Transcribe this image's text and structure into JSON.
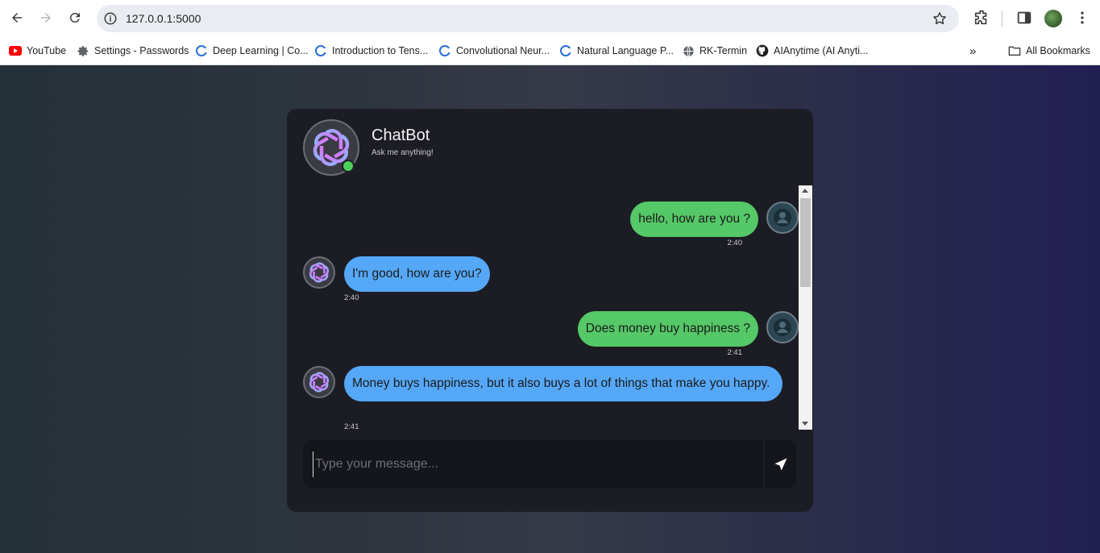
{
  "browser": {
    "url": "127.0.0.1:5000",
    "bookmarks": [
      {
        "label": "YouTube",
        "icon": "youtube-icon"
      },
      {
        "label": "Settings - Passwords",
        "icon": "gear-icon"
      },
      {
        "label": "Deep Learning | Co...",
        "icon": "coursera-icon"
      },
      {
        "label": "Introduction to Tens...",
        "icon": "coursera-icon"
      },
      {
        "label": "Convolutional Neur...",
        "icon": "coursera-icon"
      },
      {
        "label": "Natural Language P...",
        "icon": "coursera-icon"
      },
      {
        "label": "RK-Termin",
        "icon": "globe-icon"
      },
      {
        "label": "AIAnytime (AI Anyti...",
        "icon": "github-icon"
      }
    ],
    "all_bookmarks": "All Bookmarks",
    "overflow": "»"
  },
  "chat": {
    "title": "ChatBot",
    "subtitle": "Ask me anything!",
    "status": "online",
    "messages": [
      {
        "role": "user",
        "text": "hello, how are you ?",
        "time": "2:40"
      },
      {
        "role": "bot",
        "text": "I'm good, how are you?",
        "time": "2:40"
      },
      {
        "role": "user",
        "text": "Does money buy happiness ?",
        "time": "2:41"
      },
      {
        "role": "bot",
        "text": "Money buys happiness, but it also buys a lot of things that make you happy.",
        "time": "2:41"
      }
    ],
    "input_placeholder": "Type your message...",
    "input_value": ""
  },
  "colors": {
    "user_bubble": "#55c867",
    "bot_bubble": "#55a8f7",
    "panel": "#1c1d24",
    "online": "#4bd15a"
  }
}
